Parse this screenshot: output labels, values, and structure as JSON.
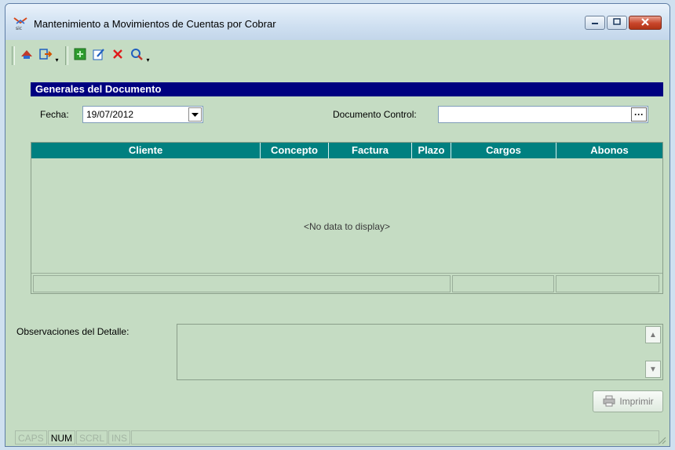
{
  "window": {
    "title": "Mantenimiento a Movimientos de Cuentas por Cobrar",
    "app_icon": "sic-app-icon",
    "controls": [
      "minimize-icon",
      "maximize-icon",
      "close-icon"
    ]
  },
  "toolbar": {
    "buttons": [
      {
        "name": "return-icon",
        "color": "#c0392b"
      },
      {
        "name": "export-icon",
        "color": "#d35400"
      },
      {
        "name": "new-record-icon",
        "color": "#2e9b2e"
      },
      {
        "name": "edit-icon",
        "color": "#1f5fbf"
      },
      {
        "name": "delete-icon",
        "color": "#e01a1a"
      },
      {
        "name": "search-icon",
        "color": "#c0392b"
      }
    ]
  },
  "section": {
    "title": "Generales del Documento"
  },
  "form": {
    "fecha_label": "Fecha:",
    "fecha_value": "19/07/2012",
    "documento_control_label": "Documento Control:",
    "documento_control_value": ""
  },
  "grid": {
    "columns": [
      "Cliente",
      "Concepto",
      "Factura",
      "Plazo",
      "Cargos",
      "Abonos"
    ],
    "empty_text": "<No data to display>",
    "header_color": "#008080"
  },
  "observaciones": {
    "label": "Observaciones del Detalle:",
    "value": ""
  },
  "print_button": {
    "label": "Imprimir",
    "enabled": false
  },
  "statusbar": {
    "items": [
      {
        "label": "CAPS",
        "active": false
      },
      {
        "label": "NUM",
        "active": true
      },
      {
        "label": "SCRL",
        "active": false
      },
      {
        "label": "INS",
        "active": false
      }
    ]
  },
  "colors": {
    "section_header": "#000080",
    "window_bg": "#c5dcc3"
  }
}
